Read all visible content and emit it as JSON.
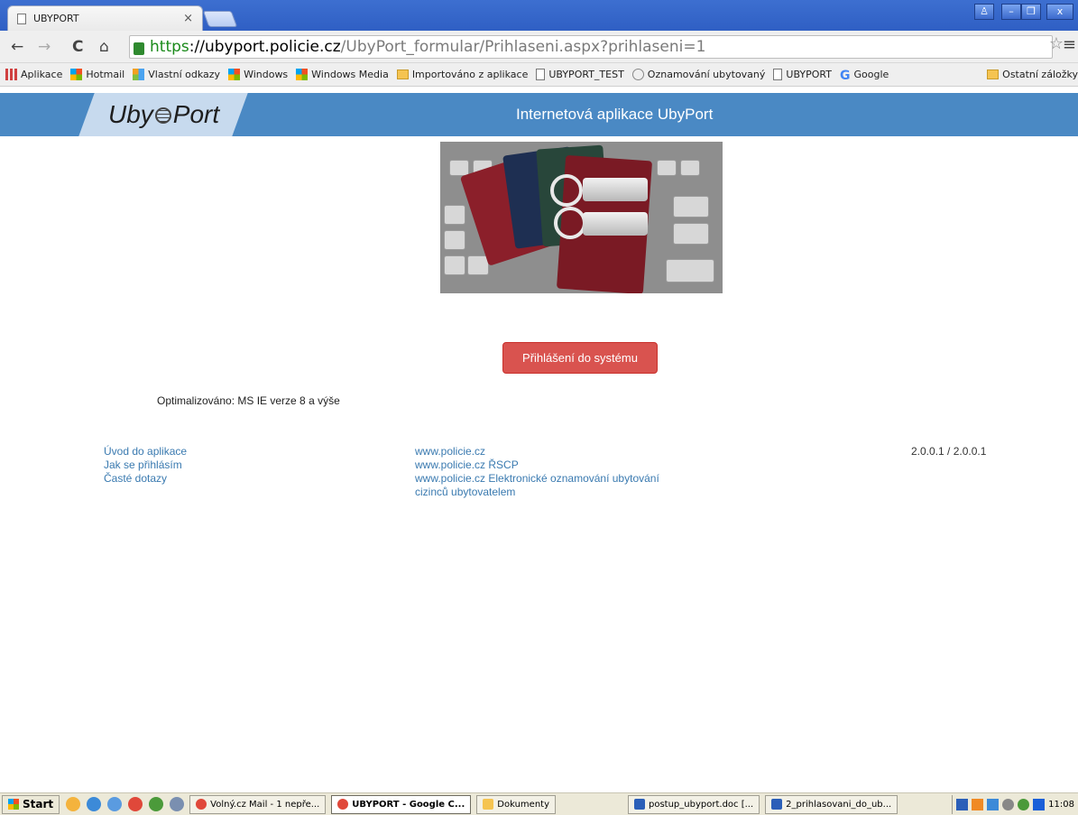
{
  "browser": {
    "tab_title": "UBYPORT",
    "tab_close": "×",
    "url_secure": "https",
    "url_host": "://ubyport.policie.cz",
    "url_path": "/UbyPort_formular/Prihlaseni.aspx?prihlaseni=1",
    "bookmarks": [
      {
        "label": "Aplikace",
        "icon": "apps-icon"
      },
      {
        "label": "Hotmail",
        "icon": "windows-icon"
      },
      {
        "label": "Vlastní odkazy",
        "icon": "windows-icon"
      },
      {
        "label": "Windows",
        "icon": "windows-icon"
      },
      {
        "label": "Windows Media",
        "icon": "windows-icon"
      },
      {
        "label": "Importováno z aplikace",
        "icon": "folder-icon"
      },
      {
        "label": "UBYPORT_TEST",
        "icon": "page-icon"
      },
      {
        "label": "Oznamování ubytovaný",
        "icon": "globe-icon"
      },
      {
        "label": "UBYPORT",
        "icon": "page-icon"
      },
      {
        "label": "Google",
        "icon": "google-icon"
      },
      {
        "label": "Ostatní záložky",
        "icon": "folder-icon"
      }
    ]
  },
  "header": {
    "logo_left": "Uby",
    "logo_right": "Port",
    "title": "Internetová aplikace UbyPort"
  },
  "main": {
    "login_button": "Přihlášení do systému",
    "optimized": "Optimalizováno: MS IE verze 8 a výše"
  },
  "footer": {
    "left_links": [
      "Úvod do aplikace",
      "Jak se přihlásím",
      "Časté dotazy"
    ],
    "middle_links": [
      "www.policie.cz",
      "www.policie.cz ŘSCP",
      "www.policie.cz Elektronické oznamování ubytování cizinců ubytovatelem"
    ],
    "version": "2.0.0.1 / 2.0.0.1"
  },
  "taskbar": {
    "start": "Start",
    "tasks": [
      {
        "label": "Volný.cz Mail - 1 nepře...",
        "active": false
      },
      {
        "label": "UBYPORT - Google C...",
        "active": true
      },
      {
        "label": "Dokumenty",
        "active": false
      },
      {
        "label": "postup_ubyport.doc [...",
        "active": false
      },
      {
        "label": "2_prihlasovani_do_ub...",
        "active": false
      }
    ],
    "clock": "11:08"
  }
}
